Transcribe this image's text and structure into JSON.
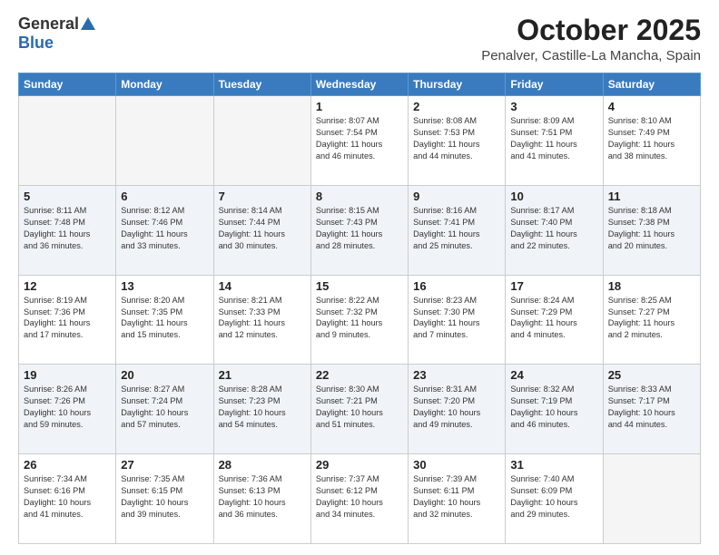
{
  "header": {
    "logo_general": "General",
    "logo_blue": "Blue",
    "title": "October 2025",
    "location": "Penalver, Castille-La Mancha, Spain"
  },
  "weekdays": [
    "Sunday",
    "Monday",
    "Tuesday",
    "Wednesday",
    "Thursday",
    "Friday",
    "Saturday"
  ],
  "weeks": [
    [
      {
        "day": "",
        "info": ""
      },
      {
        "day": "",
        "info": ""
      },
      {
        "day": "",
        "info": ""
      },
      {
        "day": "1",
        "info": "Sunrise: 8:07 AM\nSunset: 7:54 PM\nDaylight: 11 hours\nand 46 minutes."
      },
      {
        "day": "2",
        "info": "Sunrise: 8:08 AM\nSunset: 7:53 PM\nDaylight: 11 hours\nand 44 minutes."
      },
      {
        "day": "3",
        "info": "Sunrise: 8:09 AM\nSunset: 7:51 PM\nDaylight: 11 hours\nand 41 minutes."
      },
      {
        "day": "4",
        "info": "Sunrise: 8:10 AM\nSunset: 7:49 PM\nDaylight: 11 hours\nand 38 minutes."
      }
    ],
    [
      {
        "day": "5",
        "info": "Sunrise: 8:11 AM\nSunset: 7:48 PM\nDaylight: 11 hours\nand 36 minutes."
      },
      {
        "day": "6",
        "info": "Sunrise: 8:12 AM\nSunset: 7:46 PM\nDaylight: 11 hours\nand 33 minutes."
      },
      {
        "day": "7",
        "info": "Sunrise: 8:14 AM\nSunset: 7:44 PM\nDaylight: 11 hours\nand 30 minutes."
      },
      {
        "day": "8",
        "info": "Sunrise: 8:15 AM\nSunset: 7:43 PM\nDaylight: 11 hours\nand 28 minutes."
      },
      {
        "day": "9",
        "info": "Sunrise: 8:16 AM\nSunset: 7:41 PM\nDaylight: 11 hours\nand 25 minutes."
      },
      {
        "day": "10",
        "info": "Sunrise: 8:17 AM\nSunset: 7:40 PM\nDaylight: 11 hours\nand 22 minutes."
      },
      {
        "day": "11",
        "info": "Sunrise: 8:18 AM\nSunset: 7:38 PM\nDaylight: 11 hours\nand 20 minutes."
      }
    ],
    [
      {
        "day": "12",
        "info": "Sunrise: 8:19 AM\nSunset: 7:36 PM\nDaylight: 11 hours\nand 17 minutes."
      },
      {
        "day": "13",
        "info": "Sunrise: 8:20 AM\nSunset: 7:35 PM\nDaylight: 11 hours\nand 15 minutes."
      },
      {
        "day": "14",
        "info": "Sunrise: 8:21 AM\nSunset: 7:33 PM\nDaylight: 11 hours\nand 12 minutes."
      },
      {
        "day": "15",
        "info": "Sunrise: 8:22 AM\nSunset: 7:32 PM\nDaylight: 11 hours\nand 9 minutes."
      },
      {
        "day": "16",
        "info": "Sunrise: 8:23 AM\nSunset: 7:30 PM\nDaylight: 11 hours\nand 7 minutes."
      },
      {
        "day": "17",
        "info": "Sunrise: 8:24 AM\nSunset: 7:29 PM\nDaylight: 11 hours\nand 4 minutes."
      },
      {
        "day": "18",
        "info": "Sunrise: 8:25 AM\nSunset: 7:27 PM\nDaylight: 11 hours\nand 2 minutes."
      }
    ],
    [
      {
        "day": "19",
        "info": "Sunrise: 8:26 AM\nSunset: 7:26 PM\nDaylight: 10 hours\nand 59 minutes."
      },
      {
        "day": "20",
        "info": "Sunrise: 8:27 AM\nSunset: 7:24 PM\nDaylight: 10 hours\nand 57 minutes."
      },
      {
        "day": "21",
        "info": "Sunrise: 8:28 AM\nSunset: 7:23 PM\nDaylight: 10 hours\nand 54 minutes."
      },
      {
        "day": "22",
        "info": "Sunrise: 8:30 AM\nSunset: 7:21 PM\nDaylight: 10 hours\nand 51 minutes."
      },
      {
        "day": "23",
        "info": "Sunrise: 8:31 AM\nSunset: 7:20 PM\nDaylight: 10 hours\nand 49 minutes."
      },
      {
        "day": "24",
        "info": "Sunrise: 8:32 AM\nSunset: 7:19 PM\nDaylight: 10 hours\nand 46 minutes."
      },
      {
        "day": "25",
        "info": "Sunrise: 8:33 AM\nSunset: 7:17 PM\nDaylight: 10 hours\nand 44 minutes."
      }
    ],
    [
      {
        "day": "26",
        "info": "Sunrise: 7:34 AM\nSunset: 6:16 PM\nDaylight: 10 hours\nand 41 minutes."
      },
      {
        "day": "27",
        "info": "Sunrise: 7:35 AM\nSunset: 6:15 PM\nDaylight: 10 hours\nand 39 minutes."
      },
      {
        "day": "28",
        "info": "Sunrise: 7:36 AM\nSunset: 6:13 PM\nDaylight: 10 hours\nand 36 minutes."
      },
      {
        "day": "29",
        "info": "Sunrise: 7:37 AM\nSunset: 6:12 PM\nDaylight: 10 hours\nand 34 minutes."
      },
      {
        "day": "30",
        "info": "Sunrise: 7:39 AM\nSunset: 6:11 PM\nDaylight: 10 hours\nand 32 minutes."
      },
      {
        "day": "31",
        "info": "Sunrise: 7:40 AM\nSunset: 6:09 PM\nDaylight: 10 hours\nand 29 minutes."
      },
      {
        "day": "",
        "info": ""
      }
    ]
  ]
}
